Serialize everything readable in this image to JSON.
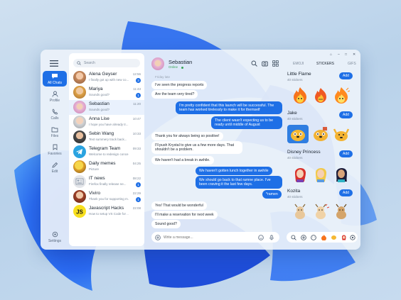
{
  "rail": {
    "items": [
      {
        "label": "All Chats"
      },
      {
        "label": "Profile"
      },
      {
        "label": "Calls"
      },
      {
        "label": "Files"
      },
      {
        "label": "Favories"
      },
      {
        "label": "Edit"
      }
    ],
    "settings_label": "Settings"
  },
  "search": {
    "placeholder": "Search"
  },
  "chats": [
    {
      "name": "Alena Geyser",
      "preview": "I finally got up with new co...",
      "time": "12:56",
      "badge": "3"
    },
    {
      "name": "Mariya",
      "preview": "Sounds good?",
      "time": "11:43",
      "badge": "1"
    },
    {
      "name": "Sebastian",
      "preview": "Sounds good?",
      "time": "11:20",
      "badge": ""
    },
    {
      "name": "Anna Lise",
      "preview": "I hope you have already tr...",
      "time": "10:47",
      "badge": ""
    },
    {
      "name": "Sebin Wang",
      "preview": "Text summery track back...",
      "time": "10:33",
      "badge": ""
    },
    {
      "name": "Telegram Team",
      "preview": "Welcome to redesign conce...",
      "time": "09:33",
      "badge": ""
    },
    {
      "name": "Daily memes",
      "preview": "Picture",
      "time": "04:25",
      "badge": ""
    },
    {
      "name": "IT news",
      "preview": "Firefox finally release ne...",
      "time": "08:22",
      "badge": "1"
    },
    {
      "name": "Viviro",
      "preview": "Thank you for supporting m...",
      "time": "22:29",
      "badge": "1"
    },
    {
      "name": "Javascript Hacks",
      "preview": "How to setup VS Code for ...",
      "time": "22:08",
      "badge": ""
    }
  ],
  "conversation": {
    "contact": "Sebastian",
    "status": "Online",
    "messages": [
      {
        "dir": "in",
        "text": "Friday late"
      },
      {
        "dir": "in",
        "text": "I've seen the progress reports"
      },
      {
        "dir": "in",
        "text": "Are the team very tired?"
      },
      {
        "dir": "out",
        "text": "I'm pretty confident that this launch will be successful. The team has worked tirelessly to make it for themself"
      },
      {
        "dir": "out",
        "text": "The client wasn't expecting us to be ready until middle of August"
      },
      {
        "dir": "in",
        "text": "Thank you for always being so positive!"
      },
      {
        "dir": "in",
        "text": "I'll push Krystal to give us a few more days. That shouldn't be a problem."
      },
      {
        "dir": "in",
        "text": "We haven't had a break in awhile."
      },
      {
        "dir": "out",
        "text": "We haven't gotten lunch together in awhile"
      },
      {
        "dir": "out",
        "text": "We should go back to that ramne place. I've been craving it the last few days."
      },
      {
        "dir": "out",
        "text": "*ramen"
      },
      {
        "dir": "in",
        "text": "Yes! That would be wonderful"
      },
      {
        "dir": "in",
        "text": "I'll make a reservation for next week"
      },
      {
        "dir": "in",
        "text": "Sound good?"
      }
    ],
    "composer_placeholder": "Write a message..."
  },
  "panel": {
    "tabs": [
      "EMOJI",
      "STICKERS",
      "GIFS"
    ],
    "packs": [
      {
        "name": "Little Flame",
        "count": "40 stickers",
        "add": "Add"
      },
      {
        "name": "Jake",
        "count": "40 stickers",
        "add": "Add"
      },
      {
        "name": "Disney Princess",
        "count": "40 stickers",
        "add": "Add"
      },
      {
        "name": "Kozita",
        "count": "40 stickers",
        "add": "Add"
      }
    ]
  },
  "colors": {
    "accent": "#1e6fe6",
    "online": "#3aa55a"
  }
}
